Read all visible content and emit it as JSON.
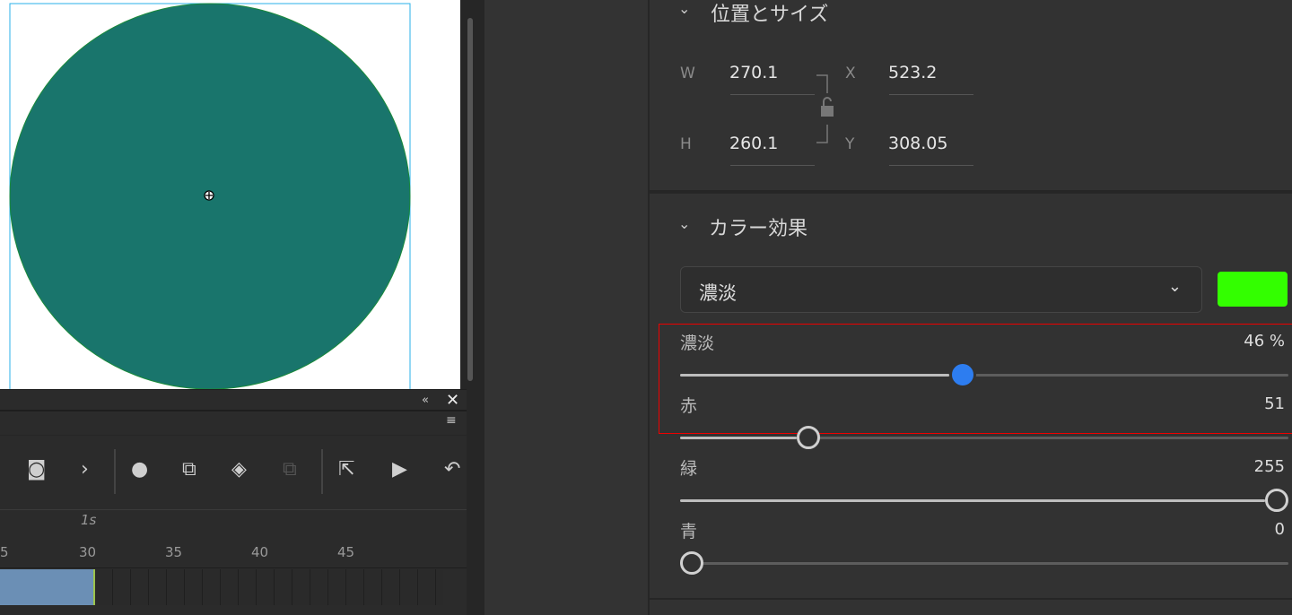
{
  "stage": {
    "shape_color": "#19756c",
    "selection_color": "#2ab2ea"
  },
  "position_size": {
    "title": "位置とサイズ",
    "w_label": "W",
    "w": "270.1",
    "h_label": "H",
    "h": "260.1",
    "x_label": "X",
    "x": "523.2",
    "y_label": "Y",
    "y": "308.05"
  },
  "color_effect": {
    "title": "カラー効果",
    "style": "濃淡",
    "tint_color": "#33ff00",
    "sliders": [
      {
        "label": "濃淡",
        "value": "46 %",
        "fraction": 0.46,
        "accent": true
      },
      {
        "label": "赤",
        "value": "51",
        "fraction": 0.2
      },
      {
        "label": "緑",
        "value": "255",
        "fraction": 1.0
      },
      {
        "label": "青",
        "value": "0",
        "fraction": 0.0
      }
    ]
  },
  "timeline": {
    "time_label": "1s",
    "frames": [
      "5",
      "30",
      "35",
      "40",
      "45"
    ]
  }
}
